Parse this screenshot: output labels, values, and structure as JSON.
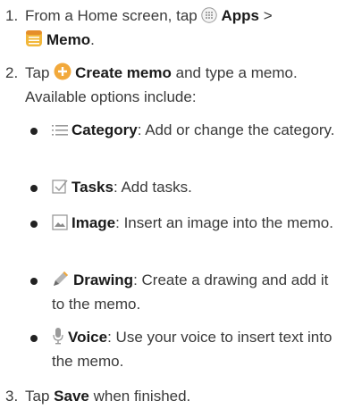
{
  "steps": [
    {
      "number": "1.",
      "prefix": "From a Home screen, tap",
      "apps_icon": "apps-grid-icon",
      "apps_label": "Apps",
      "separator": ">",
      "memo_icon": "memo-app-icon",
      "memo_label": "Memo",
      "suffix": "."
    },
    {
      "number": "2.",
      "prefix": "Tap",
      "create_icon": "add-circle-icon",
      "create_label": "Create memo",
      "text": "and type a memo. Available options include:"
    },
    {
      "number": "3.",
      "prefix": "Tap",
      "save_label": "Save",
      "suffix": "when finished."
    }
  ],
  "options": [
    {
      "icon": "list-icon",
      "label": "Category",
      "text": ": Add or change the category."
    },
    {
      "icon": "checkbox-icon",
      "label": "Tasks",
      "text": ": Add tasks."
    },
    {
      "icon": "image-icon",
      "label": "Image",
      "text": ": Insert an image into the memo."
    },
    {
      "icon": "pencil-icon",
      "label": "Drawing",
      "text": ": Create a drawing and add it to the memo."
    },
    {
      "icon": "microphone-icon",
      "label": "Voice",
      "text": ": Use your voice to insert text into the memo."
    }
  ],
  "colors": {
    "create_icon": "#f2a93b",
    "memo_icon": "#f2b73a",
    "text": "#3a3a3a"
  }
}
